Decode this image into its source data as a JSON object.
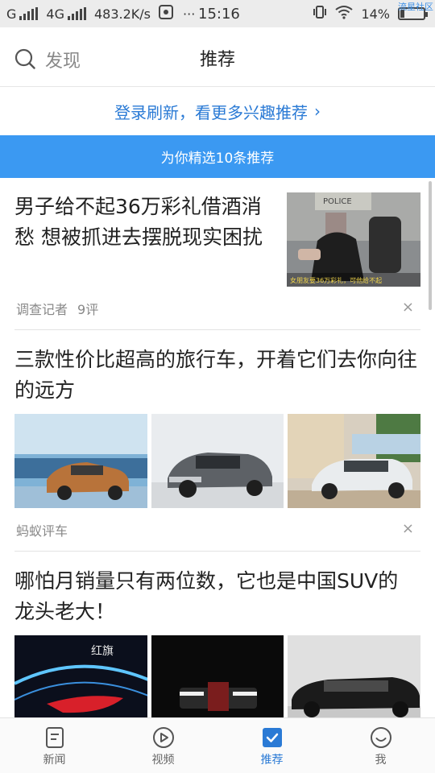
{
  "status_bar": {
    "carrier1": "G",
    "carrier2": "4G",
    "speed": "483.2K/s",
    "dots": "···",
    "time": "15:16",
    "battery": "14%",
    "watermark": "流星社区"
  },
  "header": {
    "discover_label": "发现",
    "title": "推荐"
  },
  "login_banner": {
    "text": "登录刷新，看更多兴趣推荐",
    "chevron": "›"
  },
  "recommend_bar": {
    "text": "为你精选10条推荐"
  },
  "feed": {
    "articles": [
      {
        "title": "男子给不起36万彩礼借酒消愁 想被抓进去摆脱现实困扰",
        "source": "调查记者",
        "comments": "9评",
        "thumb_caption": "女朋友要36万彩礼，可他给不起",
        "thumb_sign": "POLICE",
        "dismiss": "×"
      },
      {
        "title": "三款性价比超高的旅行车，开着它们去你向往的远方",
        "source": "蚂蚁评车",
        "dismiss": "×"
      },
      {
        "title": "哪怕月销量只有两位数，它也是中国SUV的龙头老大！",
        "img_text": "红旗"
      }
    ]
  },
  "bottom_nav": {
    "items": [
      {
        "label": "新闻",
        "icon": "news-icon"
      },
      {
        "label": "视频",
        "icon": "video-icon"
      },
      {
        "label": "推荐",
        "icon": "recommend-icon",
        "active": true
      },
      {
        "label": "我",
        "icon": "me-icon"
      }
    ]
  },
  "colors": {
    "accent": "#2a7ad5",
    "recommend_bar": "#3b99f2"
  }
}
